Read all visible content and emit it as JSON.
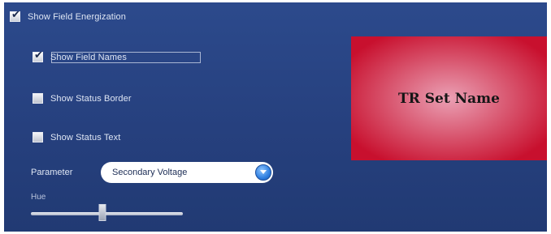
{
  "options": {
    "show_field_energization": {
      "label": "Show Field Energization",
      "checked": true
    },
    "show_field_names": {
      "label": "Show Field Names",
      "checked": true
    },
    "show_status_border": {
      "label": "Show Status Border",
      "checked": false
    },
    "show_status_text": {
      "label": "Show Status Text",
      "checked": false
    }
  },
  "parameter": {
    "label": "Parameter",
    "selected": "Secondary Voltage"
  },
  "hue": {
    "label": "Hue",
    "value_fraction": 0.47
  },
  "preview": {
    "text": "TR Set Name",
    "center_color": "#eaa0b4",
    "edge_color": "#c8102e"
  },
  "theme": {
    "panel_color": "#26407e",
    "accent": "#2f7fe0"
  },
  "icons": {
    "check": "checkmark-icon",
    "dropdown": "chevron-down-icon"
  }
}
